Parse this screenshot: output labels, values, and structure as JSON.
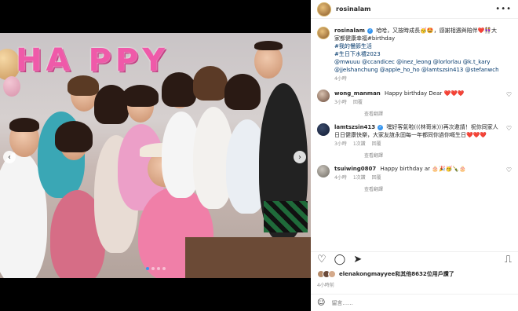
{
  "post": {
    "username": "rosinalam",
    "more": "•••"
  },
  "caption": {
    "username": "rosinalam",
    "line1": "哈哈，又按時成長🥳🤩，感謝相遇與陪伴❤️👭大",
    "line2": "家都健康幸福#birthday",
    "line3": "#我的慢節生活",
    "line4": "#生日下水禮2023",
    "line5": "@mwuuu @ccandicec @inez_leong @lorlorlau @k.t_kary",
    "line6": "@jjelshanchung @apple_ho_ho @lamtszsin413 @stefanwch",
    "time": "4小時"
  },
  "comments": [
    {
      "username": "wong_manman",
      "text": "Happy birthday Dear ❤️❤️❤️",
      "time": "3小時",
      "reply": "回覆",
      "translate": "查看翻譯",
      "view_replies": "查看回覆（1）"
    },
    {
      "username": "lamtszsin413",
      "text": "嘿好客氣啦(((林哥米)))再次邀請！祝你同家人日日健康快樂，大家友誼永固每一年都同你過你嘅生日❤️❤️❤️",
      "time": "3小時",
      "likes": "1次讚",
      "reply": "回覆",
      "translate": "查看翻譯",
      "view_replies": "查看回覆（1）"
    },
    {
      "username": "tsuiwing0807",
      "text": "Happy birthday ar 🎂🎉🥳🍾🎂",
      "time": "4小時",
      "likes": "1次讚",
      "reply": "回覆",
      "translate": "查看翻譯",
      "view_replies": "查看回覆（1）"
    }
  ],
  "likes": {
    "text": "elenakongmayyee和其他8632位用戶讚了"
  },
  "post_time": "4小時前",
  "add_comment": {
    "placeholder": "留言......"
  },
  "photo": {
    "balloon_text": [
      "H",
      "A",
      "P",
      "P",
      "Y"
    ]
  },
  "colors": {
    "accent": "#3897f0",
    "heart": "#ed4956",
    "balloon": "#ef5aa9"
  }
}
